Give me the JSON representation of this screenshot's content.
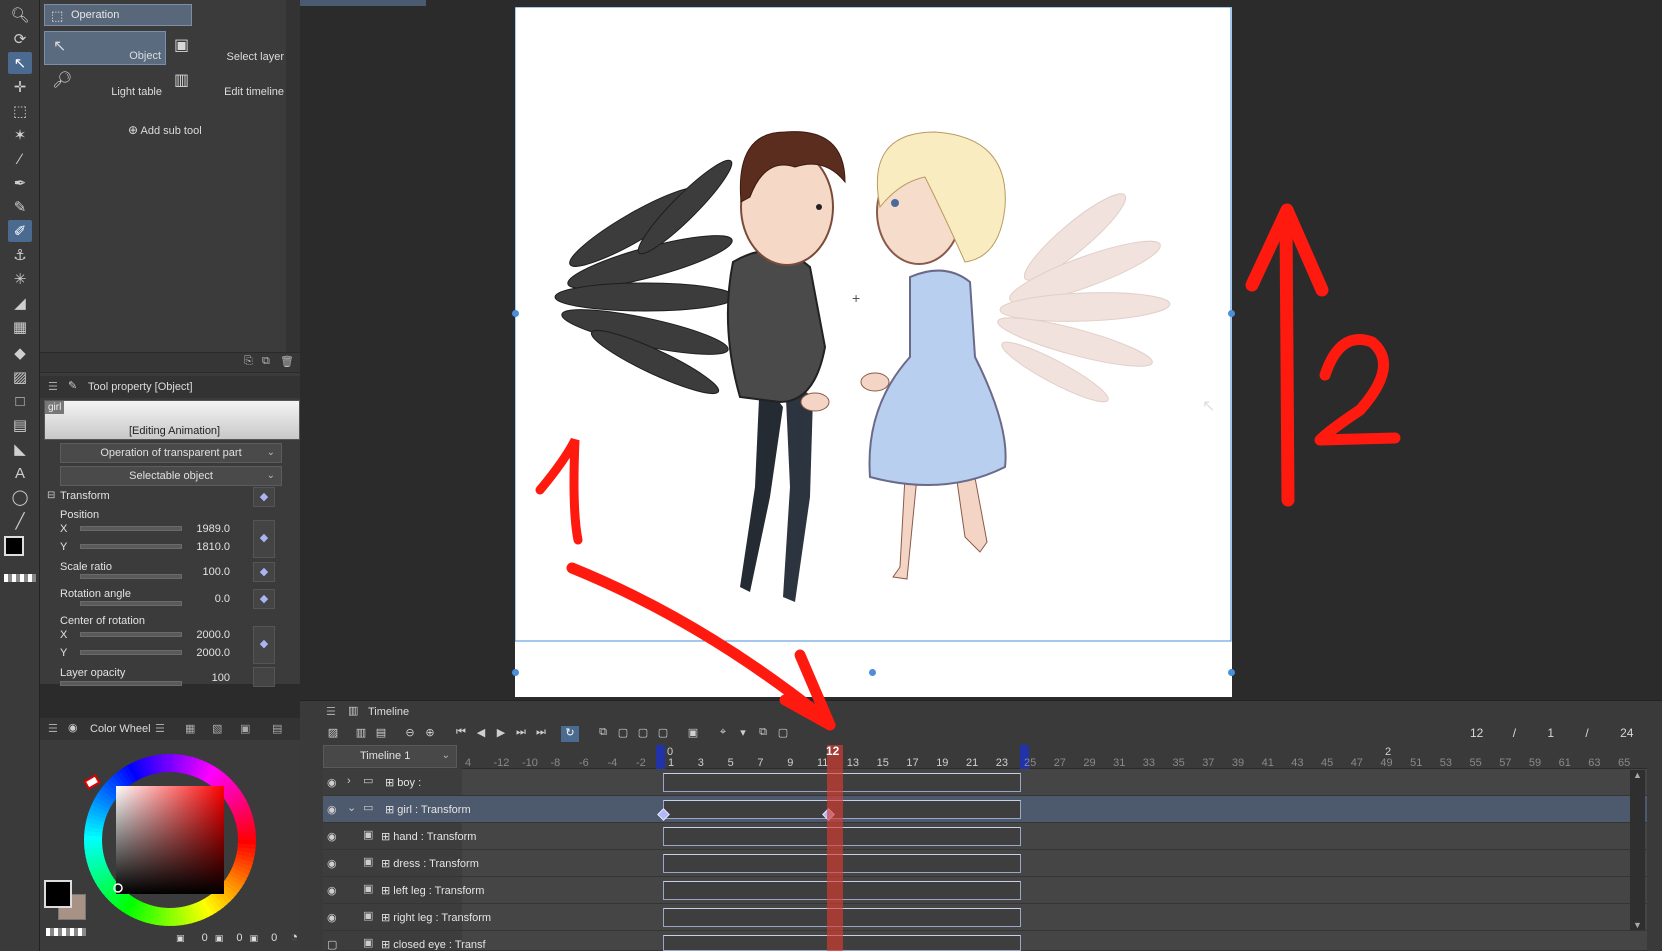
{
  "subtool": {
    "group_label": "Operation",
    "items": [
      {
        "label": "Object"
      },
      {
        "label": "Select layer"
      },
      {
        "label": "Light table"
      },
      {
        "label": "Edit timeline"
      }
    ],
    "add_label": "Add sub tool"
  },
  "toolprop": {
    "tab_label": "Tool property [Object]",
    "preview_tag": "girl",
    "preview_caption": "[Editing Animation]",
    "transparent_dropdown": "Operation of transparent part",
    "selectable_dropdown": "Selectable object",
    "transform_label": "Transform",
    "position_label": "Position",
    "x_label": "X",
    "y_label": "Y",
    "position_x": "1989.0",
    "position_y": "1810.0",
    "scale_label": "Scale ratio",
    "scale_value": "100.0",
    "rotation_label": "Rotation angle",
    "rotation_value": "0.0",
    "center_label": "Center of rotation",
    "center_x": "2000.0",
    "center_y": "2000.0",
    "opacity_label": "Layer opacity",
    "opacity_value": "100"
  },
  "colorpanel": {
    "tab_label": "Color Wheel",
    "bottom_values": [
      "0",
      "0",
      "0"
    ],
    "main_color": "#000000",
    "sub_color": "#a89286"
  },
  "timeline": {
    "tab_label": "Timeline",
    "name": "Timeline 1",
    "current_frame": "12",
    "frame_counter": [
      "12",
      "/",
      "1",
      "/",
      "24"
    ],
    "ruler_ticks_left": [
      "4",
      "-12",
      "-10",
      "-8",
      "-6",
      "-4",
      "-2"
    ],
    "ruler_ticks_main": [
      "1",
      "3",
      "5",
      "7",
      "9",
      "11",
      "13",
      "15",
      "17",
      "19",
      "21",
      "23"
    ],
    "ruler_ticks_right": [
      "25",
      "27",
      "29",
      "31",
      "33",
      "35",
      "37",
      "39",
      "41",
      "43",
      "45",
      "47",
      "49",
      "51",
      "53",
      "55",
      "57",
      "59",
      "61",
      "63",
      "65"
    ],
    "ruler_zero": "0",
    "ruler_marker_2": "2",
    "layers": [
      {
        "name": "boy :"
      },
      {
        "name": "girl : Transform"
      },
      {
        "name": "hand : Transform"
      },
      {
        "name": "dress : Transform"
      },
      {
        "name": "left leg : Transform"
      },
      {
        "name": "right leg : Transform"
      },
      {
        "name": "closed eye : Transf"
      }
    ]
  },
  "annotations": {
    "label_1": "1",
    "label_2": "2",
    "color": "#ff1a10"
  }
}
